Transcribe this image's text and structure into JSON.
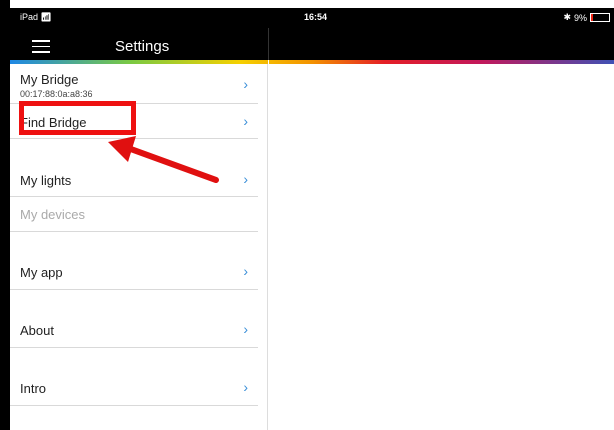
{
  "statusbar": {
    "carrier": "iPad",
    "time": "16:54",
    "battery_percent": "9%"
  },
  "navbar": {
    "title": "Settings"
  },
  "menu": {
    "items": [
      {
        "label": "My Bridge",
        "sublabel": "00:17:88:0a:a8:36",
        "chevron": "›"
      },
      {
        "label": "Find Bridge",
        "chevron": "›"
      },
      {
        "label": "My lights",
        "chevron": "›"
      },
      {
        "label": "My devices"
      },
      {
        "label": "My app",
        "chevron": "›"
      },
      {
        "label": "About",
        "chevron": "›"
      },
      {
        "label": "Intro",
        "chevron": "›"
      }
    ]
  },
  "annotation": {
    "highlight_color": "#ee1111",
    "arrow_color": "#e01010"
  },
  "colors": {
    "chevron": "#3a8fd8",
    "bar": "#000000"
  }
}
